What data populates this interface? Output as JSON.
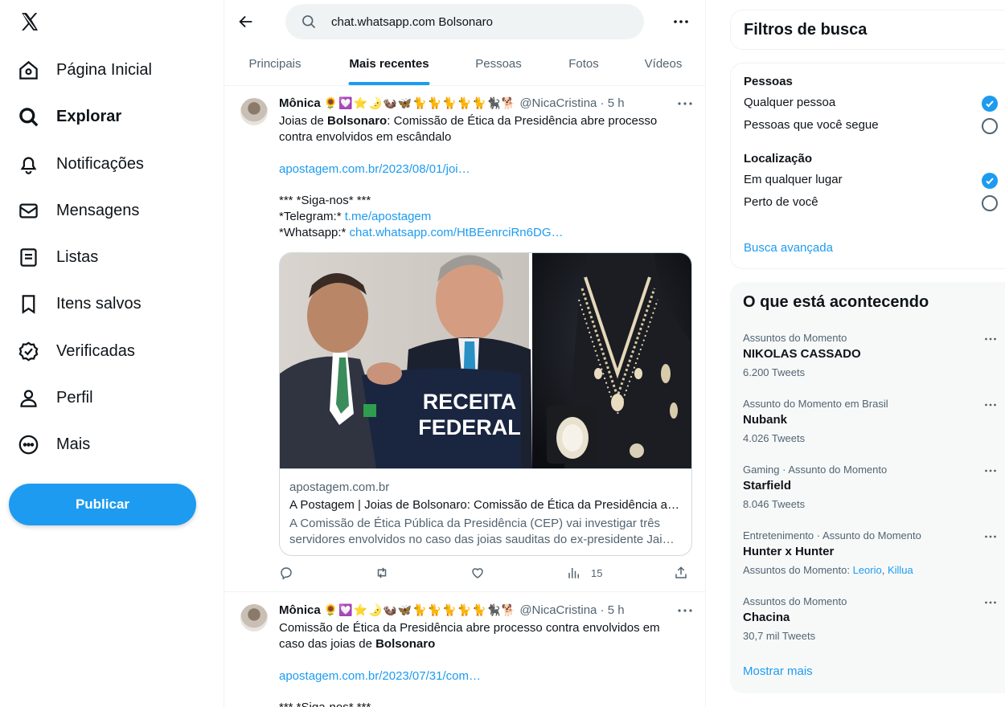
{
  "nav": {
    "items": [
      {
        "label": "Página Inicial",
        "icon": "home-icon"
      },
      {
        "label": "Explorar",
        "icon": "search-icon",
        "active": true
      },
      {
        "label": "Notificações",
        "icon": "bell-icon"
      },
      {
        "label": "Mensagens",
        "icon": "envelope-icon"
      },
      {
        "label": "Listas",
        "icon": "list-icon"
      },
      {
        "label": "Itens salvos",
        "icon": "bookmark-icon"
      },
      {
        "label": "Verificadas",
        "icon": "verified-icon"
      },
      {
        "label": "Perfil",
        "icon": "person-icon"
      },
      {
        "label": "Mais",
        "icon": "more-circle-icon"
      }
    ],
    "publish_label": "Publicar"
  },
  "search": {
    "query": "chat.whatsapp.com Bolsonaro"
  },
  "tabs": [
    "Principais",
    "Mais recentes",
    "Pessoas",
    "Fotos",
    "Vídeos"
  ],
  "tweets": [
    {
      "name": "Mônica",
      "emoji": "🌻💟⭐🌛🦦🦋🐈🐈🐈🐈🐈🐈‍⬛🐕",
      "handle_time": "@NicaCristina · 5 h",
      "text_a": "Joias de ",
      "text_bold": "Bolsonaro",
      "text_b": ": Comissão de Ética da Presidência abre processo contra envolvidos em escândalo",
      "link1": "apostagem.com.br/2023/08/01/joi…",
      "siga": "*** *Siga-nos* ***",
      "telegram_label": "*Telegram:* ",
      "telegram_link": "t.me/apostagem",
      "whatsapp_label": "*Whatsapp:* ",
      "whatsapp_link": "chat.whatsapp.com/HtBEenrciRn6DG…",
      "card": {
        "image_text_1": "RECEITA",
        "image_text_2": "FEDERAL",
        "domain": "apostagem.com.br",
        "title": "A Postagem | Joias de Bolsonaro: Comissão de Ética da Presidência a…",
        "desc": "A Comissão de Ética Pública da Presidência (CEP) vai investigar três servidores envolvidos no caso das joias sauditas do ex-presidente Jai…"
      },
      "views": "15"
    },
    {
      "name": "Mônica",
      "emoji": "🌻💟⭐🌛🦦🦋🐈🐈🐈🐈🐈🐈‍⬛🐕",
      "handle_time": "@NicaCristina · 5 h",
      "text_a": "Comissão de Ética da Presidência abre processo contra envolvidos em caso das joias de ",
      "text_bold": "Bolsonaro",
      "link1": "apostagem.com.br/2023/07/31/com…",
      "siga": "*** *Siga-nos* ***"
    }
  ],
  "filters": {
    "title": "Filtros de busca",
    "people_heading": "Pessoas",
    "people_options": [
      "Qualquer pessoa",
      "Pessoas que você segue"
    ],
    "people_selected": 0,
    "location_heading": "Localização",
    "location_options": [
      "Em qualquer lugar",
      "Perto de você"
    ],
    "location_selected": 0,
    "advanced": "Busca avançada"
  },
  "trends": {
    "title": "O que está acontecendo",
    "items": [
      {
        "category": "Assuntos do Momento",
        "name": "NIKOLAS CASSADO",
        "count": "6.200 Tweets"
      },
      {
        "category": "Assunto do Momento em Brasil",
        "name": "Nubank",
        "count": "4.026 Tweets"
      },
      {
        "category": "Gaming · Assunto do Momento",
        "name": "Starfield",
        "count": "8.046 Tweets"
      },
      {
        "category": "Entretenimento · Assunto do Momento",
        "name": "Hunter x Hunter",
        "count_prefix": "Assuntos do Momento: ",
        "count_links": [
          "Leorio",
          "Killua"
        ],
        "count_sep": ", "
      },
      {
        "category": "Assuntos do Momento",
        "name": "Chacina",
        "count": "30,7 mil Tweets"
      }
    ],
    "show_more": "Mostrar mais"
  },
  "colors": {
    "accent": "#1d9bf0",
    "text": "#0f1419",
    "secondary": "#536471",
    "border": "#eff3f4"
  }
}
